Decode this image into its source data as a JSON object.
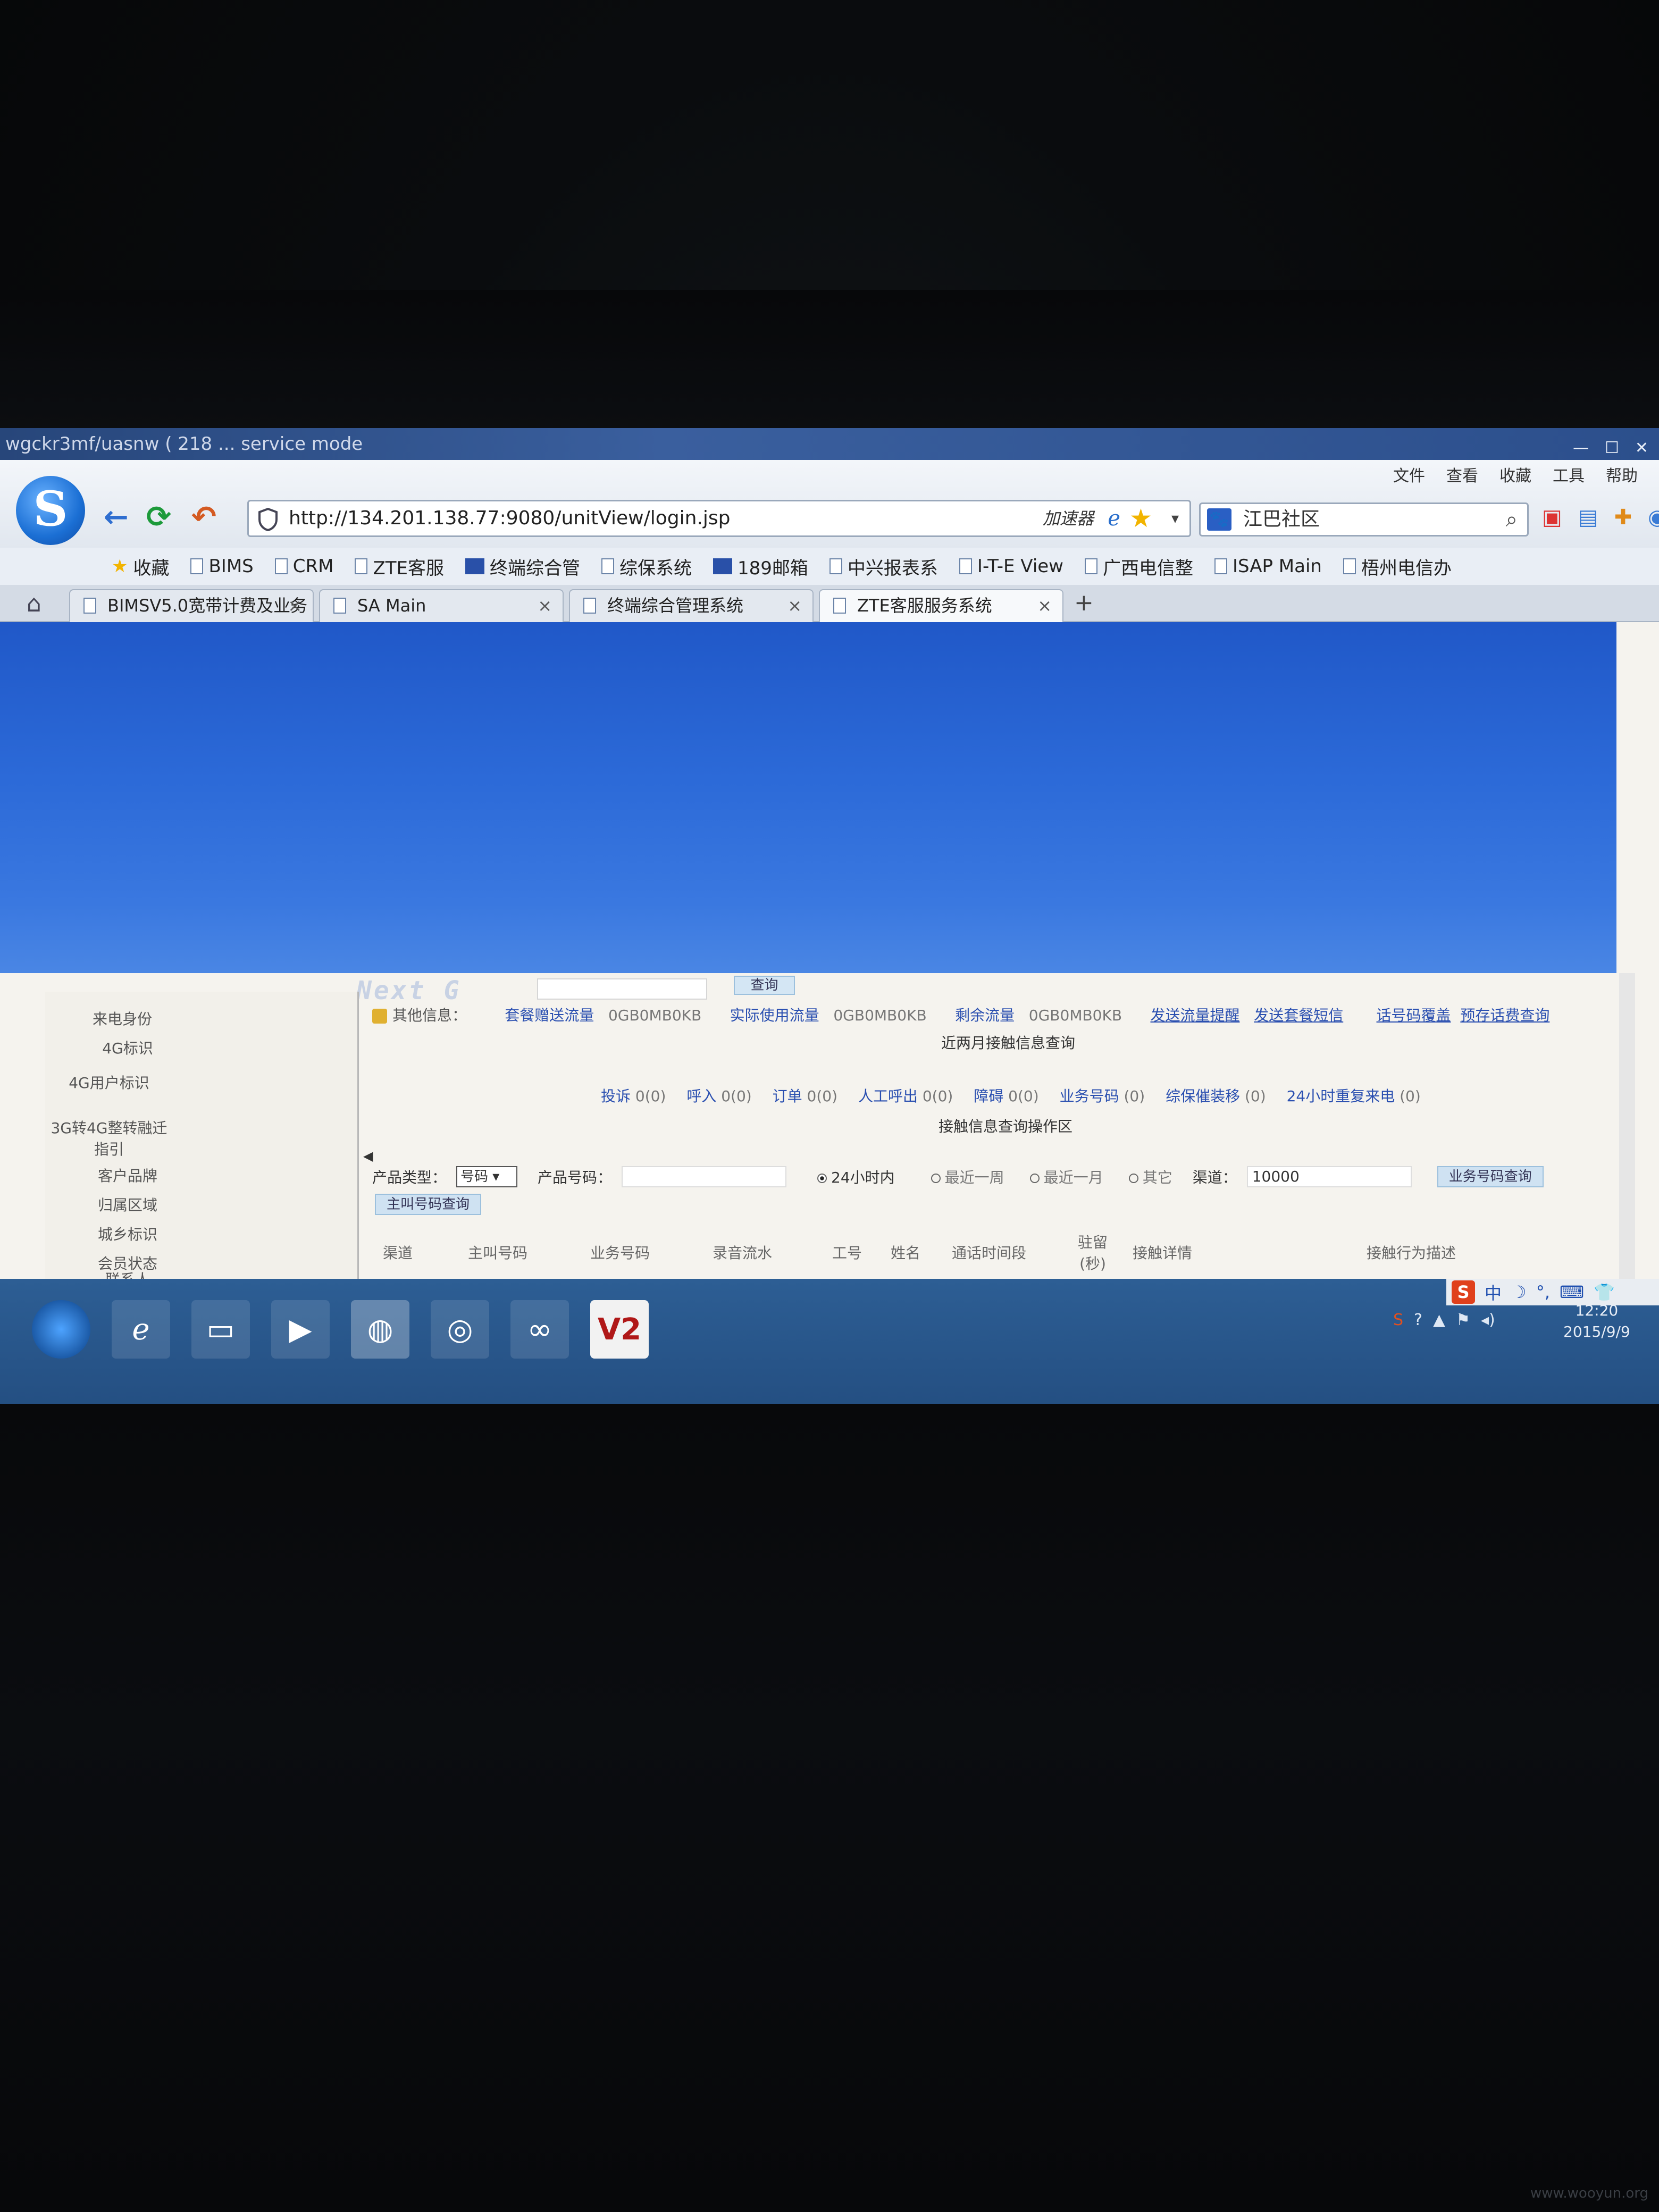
{
  "window": {
    "title": "wgckr3mf/uasnw ( 218 ... service mode"
  },
  "browser": {
    "logo": "S",
    "url": "http://134.201.138.77:9080/unitView/login.jsp",
    "accelerator_label": "加速器",
    "search_value": "江巴社区",
    "menu": [
      "文件",
      "查看",
      "收藏",
      "工具",
      "帮助"
    ],
    "favorites": [
      {
        "label": "收藏"
      },
      {
        "label": "BIMS"
      },
      {
        "label": "CRM"
      },
      {
        "label": "ZTE客服"
      },
      {
        "label": "终端综合管"
      },
      {
        "label": "综保系统"
      },
      {
        "label": "189邮箱"
      },
      {
        "label": "中兴报表系"
      },
      {
        "label": "I-T-E View"
      },
      {
        "label": "广西电信整"
      },
      {
        "label": "ISAP Main"
      },
      {
        "label": "梧州电信办"
      }
    ],
    "tabs": [
      {
        "label": "BIMSV5.0宽带计费及业务"
      },
      {
        "label": "SA Main"
      },
      {
        "label": "终端综合管理系统"
      },
      {
        "label": "ZTE客服服务系统"
      }
    ],
    "tab_close": "×",
    "newtab_label": "+"
  },
  "page": {
    "header_text": "Next G",
    "top_query_label": "查询",
    "left_items": [
      "来电身份",
      "4G标识",
      "4G用户标识",
      "3G转4G整转融迁指引",
      "客户品牌",
      "归属区域",
      "城乡标识",
      "会员状态",
      "联系人"
    ],
    "other_info": {
      "label": "其他信息：",
      "items": [
        {
          "link": "套餐赠送流量",
          "value": "0GB0MB0KB"
        },
        {
          "link": "实际使用流量",
          "value": "0GB0MB0KB"
        },
        {
          "link": "剩余流量",
          "value": "0GB0MB0KB"
        }
      ],
      "links": [
        "发送流量提醒",
        "发送套餐短信",
        "话号码覆盖",
        "预存话费查询"
      ]
    },
    "recent_title": "近两月接触信息查询",
    "recent_items": [
      {
        "label": "投诉",
        "count": "0(0)"
      },
      {
        "label": "呼入",
        "count": "0(0)"
      },
      {
        "label": "订单",
        "count": "0(0)"
      },
      {
        "label": "人工呼出",
        "count": "0(0)"
      },
      {
        "label": "障碍",
        "count": "0(0)"
      },
      {
        "label": "业务号码",
        "count": "(0)"
      },
      {
        "label": "综保催装移",
        "count": "(0)"
      },
      {
        "label": "24小时重复来电",
        "count": "(0)"
      }
    ],
    "ops_title": "接触信息查询操作区",
    "product_type_label": "产品类型：",
    "product_type_value": "号码",
    "product_no_label": "产品号码：",
    "time_options": [
      "24小时内",
      "最近一周",
      "最近一月",
      "其它"
    ],
    "channel_label": "渠道：",
    "channel_value": "10000",
    "business_query_btn": "业务号码查询",
    "caller_query_btn": "主叫号码查询",
    "table_headers": [
      "渠道",
      "主叫号码",
      "业务号码",
      "录音流水",
      "工号",
      "姓名",
      "通话时间段",
      "驻留(秒)",
      "接触详情",
      "接触行为描述"
    ]
  },
  "taskbar": {
    "ime": [
      "S",
      "中",
      "☽",
      "°,",
      "⌨",
      "👕",
      "⚡"
    ],
    "tray": [
      "S",
      "?",
      "▲",
      "⚑",
      "◂)"
    ],
    "time": "12:20",
    "date": "2015/9/9",
    "active_app_label": "V2"
  },
  "watermark": "www.wooyun.org"
}
